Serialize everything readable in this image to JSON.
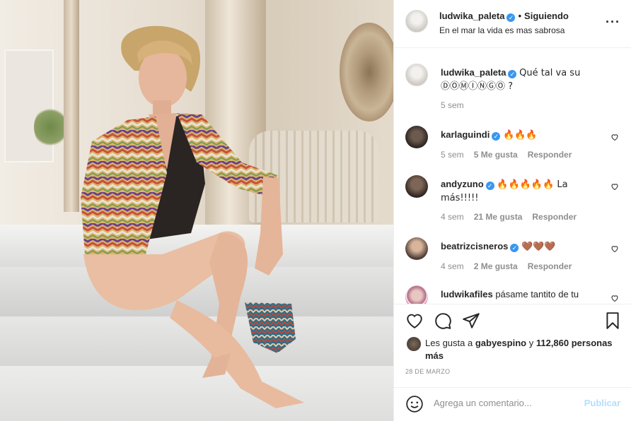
{
  "post": {
    "username": "ludwika_paleta",
    "separator": "•",
    "follow_state": "Siguiendo",
    "location": "En el mar la vida es mas sabrosa",
    "more_icon": "more-options-icon"
  },
  "caption": {
    "username": "ludwika_paleta",
    "text": "Qué tal va su ⒹⓄⓂⒾⓃⒼⓄ ?",
    "time": "5 sem"
  },
  "comments": [
    {
      "username": "karlaguindi",
      "verified": true,
      "text": "🔥🔥🔥",
      "time": "5 sem",
      "likes": "5 Me gusta",
      "reply": "Responder"
    },
    {
      "username": "andyzuno",
      "verified": true,
      "text": "🔥🔥🔥🔥🔥 La más!!!!!",
      "time": "4 sem",
      "likes": "21 Me gusta",
      "reply": "Responder"
    },
    {
      "username": "beatrizcisneros",
      "verified": true,
      "text": "🤎🤎🤎",
      "time": "4 sem",
      "likes": "2 Me gusta",
      "reply": "Responder"
    },
    {
      "username": "ludwikafiles",
      "verified": false,
      "text": "pásame tantito de tu",
      "time": "",
      "likes": "",
      "reply": ""
    }
  ],
  "likes": {
    "prefix": "Les gusta a",
    "user": "gabyespino",
    "conj": "y",
    "count": "112,860 personas más"
  },
  "date": "28 DE MARZO",
  "add_comment": {
    "placeholder": "Agrega un comentario...",
    "publish": "Publicar"
  },
  "colors": {
    "verified": "#3897f0",
    "publish_disabled": "#b2dffc",
    "muted": "#8e8e8e"
  }
}
